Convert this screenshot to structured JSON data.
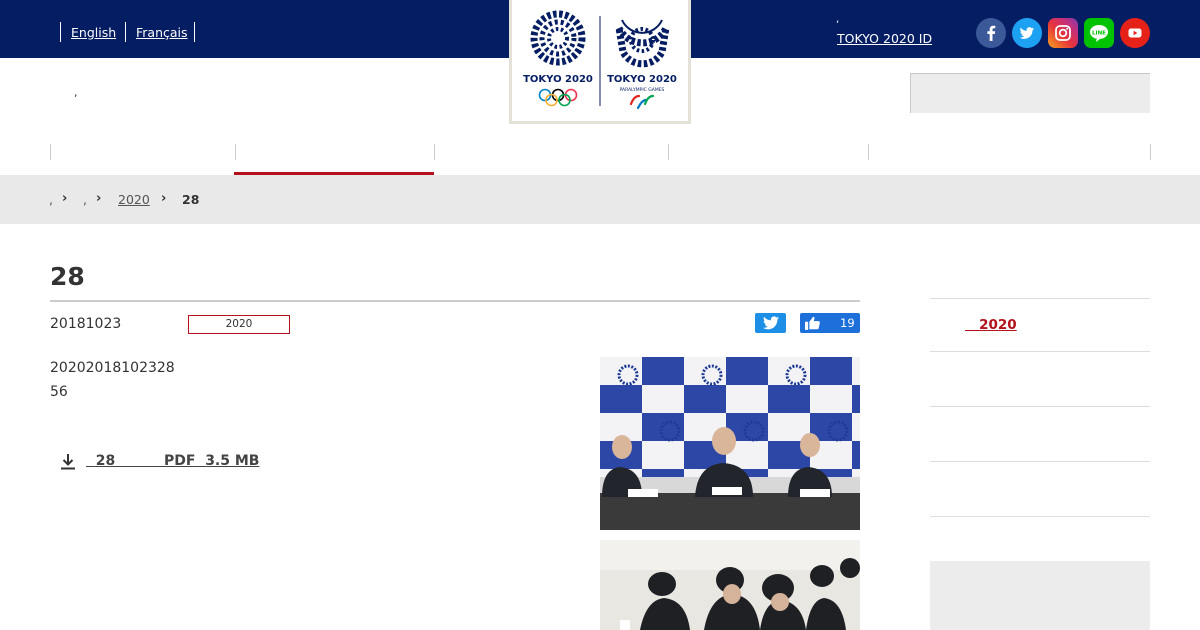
{
  "topbar": {
    "languages": [
      "English",
      "Français"
    ],
    "tokyo_id_label": "TOKYO 2020 ID",
    "tokyo_id_mark": ",",
    "social": [
      "facebook-icon",
      "twitter-icon",
      "instagram-icon",
      "line-icon",
      "youtube-icon"
    ]
  },
  "logo": {
    "olympic_text": "TOKYO 2020",
    "paralympic_text": "TOKYO 2020",
    "paralympic_sub": "PARALYMPIC GAMES"
  },
  "header": {
    "mark": ","
  },
  "breadcrumb": {
    "items": [
      ",",
      ",",
      "2020"
    ],
    "current": "28"
  },
  "article": {
    "title": "28",
    "date": "20181023",
    "tag": "2020",
    "like_count": "19",
    "lines": [
      "20202018102328",
      "56"
    ],
    "download": {
      "number": "28",
      "format": "PDF",
      "size": "3.5 MB"
    }
  },
  "sidebar": {
    "active_link": "2020"
  },
  "colors": {
    "navy": "#051d63",
    "accent_red": "#b3111b",
    "facebook": "#3b5998",
    "twitter": "#1da1f2",
    "line": "#00c300",
    "youtube": "#e62117"
  }
}
